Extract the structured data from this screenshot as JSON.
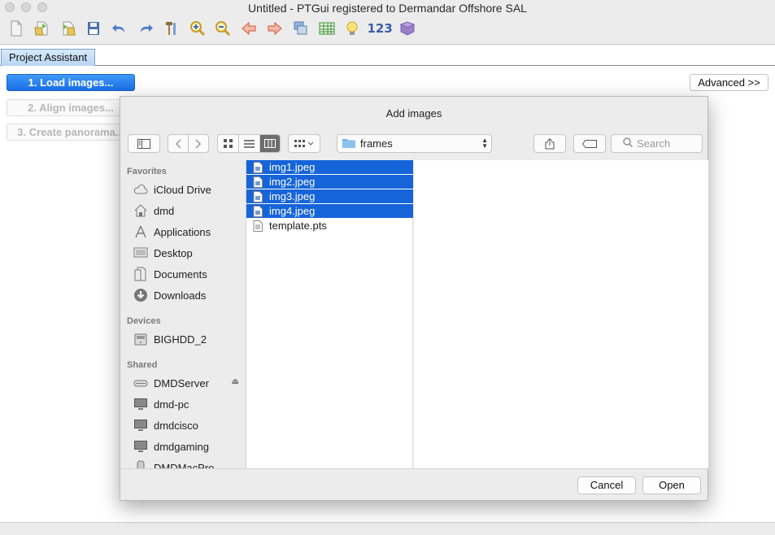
{
  "window": {
    "title": "Untitled - PTGui registered to Dermandar Offshore SAL"
  },
  "toolbar": {
    "icons": [
      "new-icon",
      "open-icon",
      "open-recent-icon",
      "save-icon",
      "undo-icon",
      "redo-icon",
      "tools-icon",
      "zoom-in-icon",
      "zoom-out-icon",
      "previous-icon",
      "next-icon",
      "images-icon",
      "table-icon",
      "lightbulb-icon",
      "numbers-icon",
      "book-icon"
    ],
    "numbers_label": "123"
  },
  "tabs": {
    "project_assistant": "Project Assistant"
  },
  "steps": {
    "load": "1. Load images...",
    "align": "2. Align images...",
    "create": "3. Create panorama..."
  },
  "advanced_label": "Advanced >>",
  "dialog": {
    "title": "Add images",
    "folder": "frames",
    "search_placeholder": "Search",
    "sidebar": {
      "favorites_header": "Favorites",
      "favorites": [
        "iCloud Drive",
        "dmd",
        "Applications",
        "Desktop",
        "Documents",
        "Downloads"
      ],
      "devices_header": "Devices",
      "devices": [
        "BIGHDD_2"
      ],
      "shared_header": "Shared",
      "shared": [
        "DMDServer",
        "dmd-pc",
        "dmdcisco",
        "dmdgaming",
        "DMDMacPro"
      ]
    },
    "files": [
      {
        "name": "img1.jpeg",
        "selected": true
      },
      {
        "name": "img2.jpeg",
        "selected": true
      },
      {
        "name": "img3.jpeg",
        "selected": true
      },
      {
        "name": "img4.jpeg",
        "selected": true
      },
      {
        "name": "template.pts",
        "selected": false
      }
    ],
    "cancel_label": "Cancel",
    "open_label": "Open"
  },
  "colors": {
    "selection": "#1664d9",
    "primary_button": "#1a6de5"
  }
}
